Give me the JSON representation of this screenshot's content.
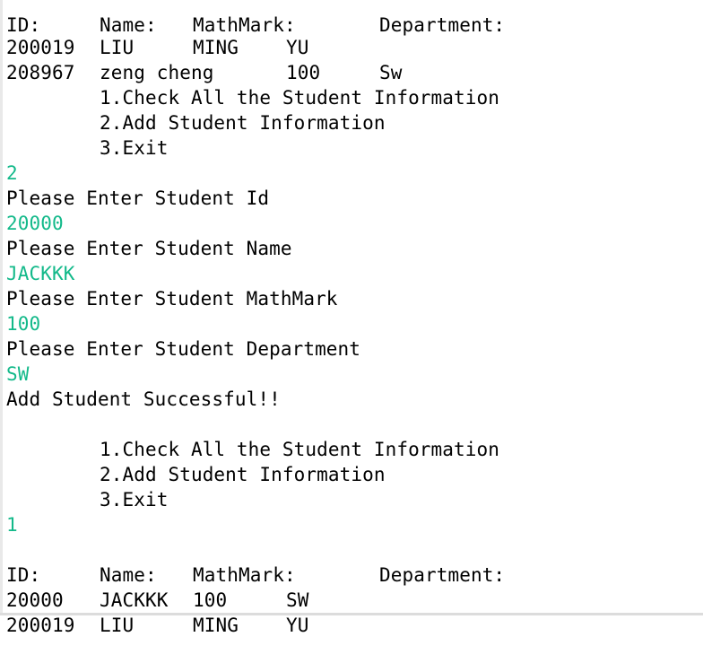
{
  "console": {
    "header_clipped": {
      "id": "ID:",
      "name": "Name:",
      "mark": "MathMark:",
      "dept": "Department:"
    },
    "top_rows": [
      {
        "id": "200019",
        "name": "LIU",
        "mark": "MING",
        "dept": "YU"
      },
      {
        "id": "208967",
        "name": "zeng cheng",
        "mark": "100",
        "dept": "Sw"
      }
    ],
    "menu_1": {
      "item1": "1.Check All the Student Information",
      "item2": "2.Add Student Information",
      "item3": "3.Exit"
    },
    "input_choice_1": "2",
    "prompt_id": "Please Enter Student Id",
    "input_id": "20000",
    "prompt_name": "Please Enter Student Name",
    "input_name": "JACKKK",
    "prompt_mark": "Please Enter Student MathMark",
    "input_mark": "100",
    "prompt_dept": "Please Enter Student Department",
    "input_dept": "SW",
    "success": "Add Student Successful!!",
    "menu_2": {
      "item1": "1.Check All the Student Information",
      "item2": "2.Add Student Information",
      "item3": "3.Exit"
    },
    "input_choice_2": "1",
    "table_header": {
      "id": "ID:",
      "name": "Name:",
      "mark": "MathMark:",
      "dept": "Department:"
    },
    "bottom_rows": [
      {
        "id": "20000",
        "name": "JACKKK",
        "mark": "100",
        "dept": "SW"
      },
      {
        "id": "200019",
        "name": "LIU",
        "mark": "MING",
        "dept": "YU"
      }
    ]
  },
  "colors": {
    "background": "#ffffff",
    "text": "#000000",
    "input_text": "#13b98a"
  }
}
